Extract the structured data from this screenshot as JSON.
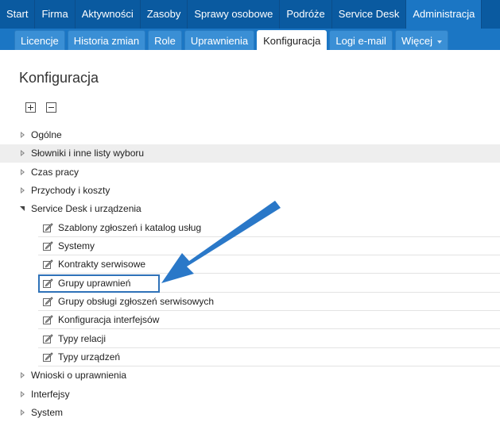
{
  "topnav": {
    "items": [
      {
        "label": "Start"
      },
      {
        "label": "Firma"
      },
      {
        "label": "Aktywności"
      },
      {
        "label": "Zasoby"
      },
      {
        "label": "Sprawy osobowe"
      },
      {
        "label": "Podróże"
      },
      {
        "label": "Service Desk"
      },
      {
        "label": "Administracja"
      }
    ],
    "active_index": 7,
    "bar_color": "#0a5aa0",
    "active_color": "#1b76c4"
  },
  "subtabs": {
    "items": [
      {
        "label": "Licencje"
      },
      {
        "label": "Historia zmian"
      },
      {
        "label": "Role"
      },
      {
        "label": "Uprawnienia"
      },
      {
        "label": "Konfiguracja"
      },
      {
        "label": "Logi e-mail"
      },
      {
        "label": "Więcej"
      }
    ],
    "active_index": 4
  },
  "page": {
    "title": "Konfiguracja"
  },
  "toolbar": {
    "expand_icon": "expand-all-icon",
    "collapse_icon": "collapse-all-icon"
  },
  "tree": {
    "nodes": [
      {
        "label": "Ogólne",
        "expanded": false
      },
      {
        "label": "Słowniki i inne listy wyboru",
        "expanded": false,
        "highlighted_row": true
      },
      {
        "label": "Czas pracy",
        "expanded": false
      },
      {
        "label": "Przychody i koszty",
        "expanded": false
      },
      {
        "label": "Service Desk i urządzenia",
        "expanded": true,
        "children": [
          {
            "label": "Szablony zgłoszeń i katalog usług"
          },
          {
            "label": "Systemy"
          },
          {
            "label": "Kontrakty serwisowe"
          },
          {
            "label": "Grupy uprawnień",
            "outlined": true
          },
          {
            "label": "Grupy obsługi zgłoszeń serwisowych"
          },
          {
            "label": "Konfiguracja interfejsów"
          },
          {
            "label": "Typy relacji"
          },
          {
            "label": "Typy urządzeń"
          }
        ]
      },
      {
        "label": "Wnioski o uprawnienia",
        "expanded": false
      },
      {
        "label": "Interfejsy",
        "expanded": false
      },
      {
        "label": "System",
        "expanded": false
      }
    ]
  },
  "annotation": {
    "arrow_color": "#2a78c8",
    "outline_color": "#2f72b8"
  }
}
